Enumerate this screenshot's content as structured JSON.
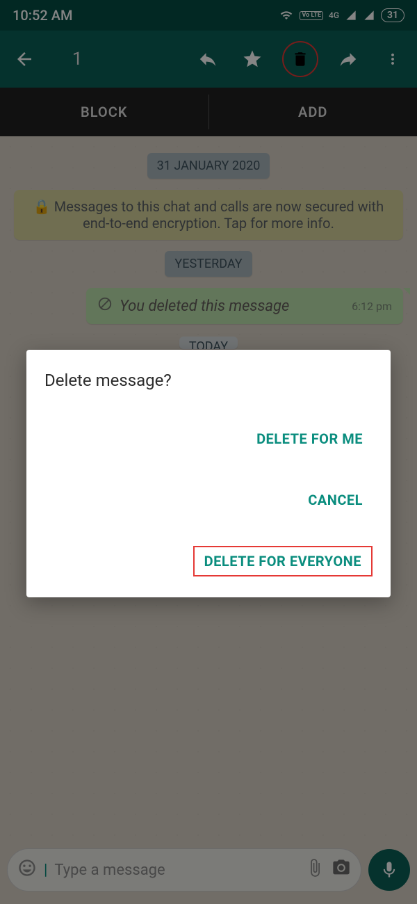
{
  "status": {
    "time": "10:52 AM",
    "network_label": "4G",
    "volte_badge": "Vo LTE",
    "battery": "31"
  },
  "appbar": {
    "selected_count": "1"
  },
  "contact_actions": {
    "block": "BLOCK",
    "add": "ADD"
  },
  "chat": {
    "date1": "31 JANUARY 2020",
    "encryption": "Messages to this chat and calls are now secured with end-to-end encryption. Tap for more info.",
    "date2": "YESTERDAY",
    "deleted_msg": "You deleted this message",
    "deleted_time": "6:12 pm",
    "date3": "TODAY"
  },
  "dialog": {
    "title": "Delete message?",
    "delete_me": "DELETE FOR ME",
    "cancel": "CANCEL",
    "delete_all": "DELETE FOR EVERYONE"
  },
  "input": {
    "placeholder": "Type a message"
  }
}
